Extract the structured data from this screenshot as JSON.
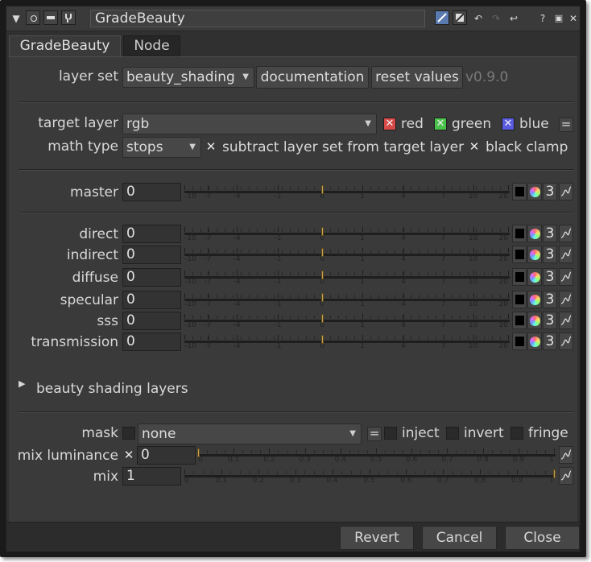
{
  "titlebar": {
    "node_name": "GradeBeauty",
    "help": "?"
  },
  "tabs": [
    {
      "label": "GradeBeauty",
      "active": true
    },
    {
      "label": "Node",
      "active": false
    }
  ],
  "layer_set": {
    "label": "layer set",
    "value": "beauty_shading",
    "documentation": "documentation",
    "reset": "reset values",
    "version": "v0.9.0"
  },
  "target": {
    "label": "target layer",
    "value": "rgb",
    "channels": [
      {
        "label": "red",
        "checked": true,
        "color": "#d84a4a"
      },
      {
        "label": "green",
        "checked": true,
        "color": "#4ac24a"
      },
      {
        "label": "blue",
        "checked": true,
        "color": "#5a5ae0"
      }
    ],
    "eq": "="
  },
  "math": {
    "label": "math type",
    "value": "stops",
    "subtract": {
      "label": "subtract layer set from target layer",
      "checked": true
    },
    "clamp": {
      "label": "black clamp",
      "checked": true
    }
  },
  "stops_ticks": [
    "-10",
    "-7",
    "-4",
    "-1",
    "0",
    "1",
    "4",
    "7",
    "10",
    "20"
  ],
  "master": {
    "label": "master",
    "value": "0",
    "count": "3"
  },
  "layers": [
    {
      "label": "direct",
      "value": "0",
      "count": "3"
    },
    {
      "label": "indirect",
      "value": "0",
      "count": "3"
    },
    {
      "label": "diffuse",
      "value": "0",
      "count": "3"
    },
    {
      "label": "specular",
      "value": "0",
      "count": "3"
    },
    {
      "label": "sss",
      "value": "0",
      "count": "3"
    },
    {
      "label": "transmission",
      "value": "0",
      "count": "3"
    }
  ],
  "group": {
    "label": "beauty shading layers",
    "expanded": false
  },
  "mask": {
    "label": "mask",
    "value": "none",
    "eq": "=",
    "inject": "inject",
    "invert": "invert",
    "fringe": "fringe"
  },
  "mix_luminance": {
    "label": "mix luminance",
    "value": "0",
    "checked": true
  },
  "mix": {
    "label": "mix",
    "value": "1"
  },
  "unit_ticks": [
    "0",
    "0.1",
    "0.2",
    "0.3",
    "0.4",
    "0.5",
    "0.6",
    "0.7",
    "0.8",
    "0.9",
    "1"
  ],
  "footer": {
    "revert": "Revert",
    "cancel": "Cancel",
    "close": "Close"
  },
  "colors": {
    "accent_handle": "#c9a24a",
    "background": "#3a3a3a"
  }
}
